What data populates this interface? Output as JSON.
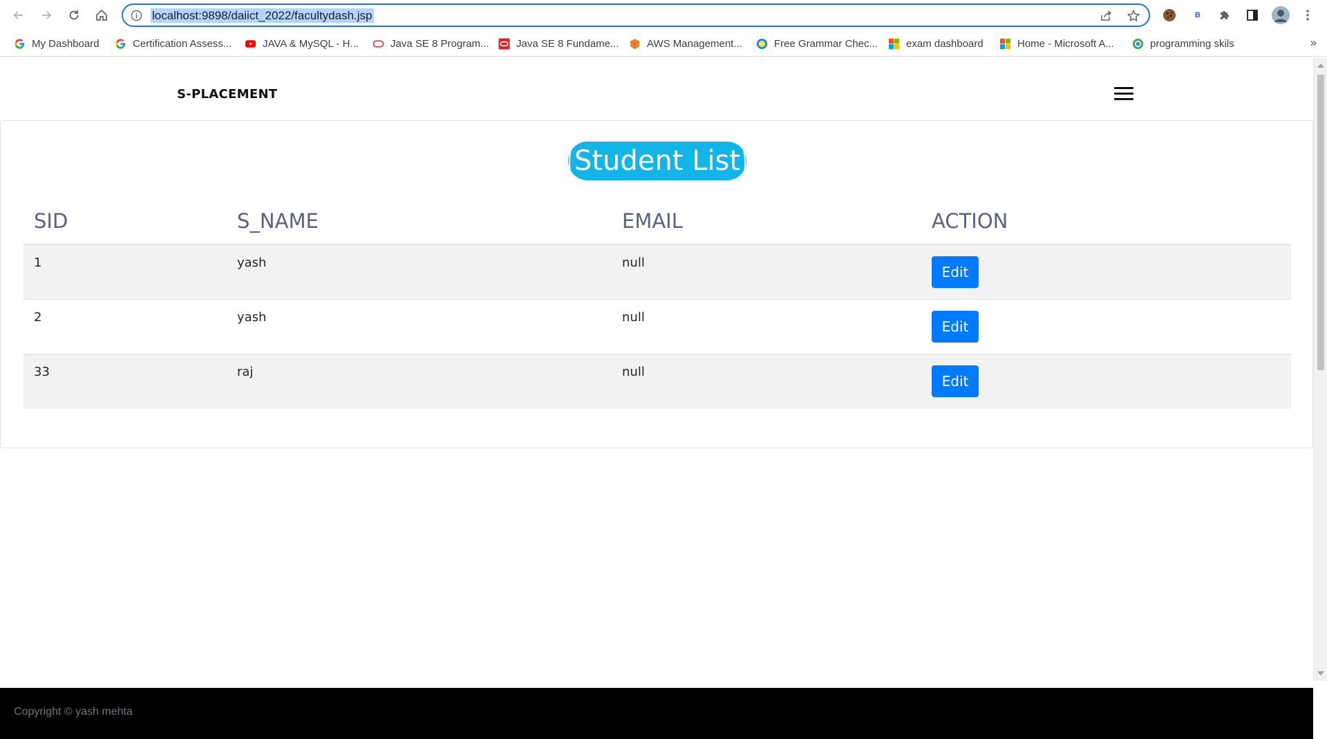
{
  "browser": {
    "url": "localhost:9898/daiict_2022/facultydash.jsp",
    "bookmarks": [
      {
        "label": "My Dashboard",
        "icon": "google-icon"
      },
      {
        "label": "Certification Assess...",
        "icon": "google-icon"
      },
      {
        "label": "JAVA & MySQL - H...",
        "icon": "youtube-icon"
      },
      {
        "label": "Java SE 8 Program...",
        "icon": "oracle-icon"
      },
      {
        "label": "Java SE 8 Fundame...",
        "icon": "oracle-icon"
      },
      {
        "label": "AWS Management...",
        "icon": "aws-icon"
      },
      {
        "label": "Free Grammar Chec...",
        "icon": "grammar-icon"
      },
      {
        "label": "exam dashboard",
        "icon": "microsoft-icon"
      },
      {
        "label": "Home - Microsoft A...",
        "icon": "microsoft-icon"
      },
      {
        "label": "programming skils",
        "icon": "chrome-icon"
      }
    ],
    "more": "»",
    "extension_letter": "B"
  },
  "navbar": {
    "brand": "S-PLACEMENT"
  },
  "main": {
    "title": "Student List",
    "columns": [
      "SID",
      "S_NAME",
      "EMAIL",
      "ACTION"
    ],
    "rows": [
      {
        "sid": "1",
        "name": "yash",
        "email": "null",
        "action": "Edit"
      },
      {
        "sid": "2",
        "name": "yash",
        "email": "null",
        "action": "Edit"
      },
      {
        "sid": "33",
        "name": "raj",
        "email": "null",
        "action": "Edit"
      }
    ]
  },
  "footer": {
    "text": "Copyright © yash mehta"
  },
  "colors": {
    "accent": "#13b4e7",
    "button": "#007bff",
    "header_text": "#5a6183"
  }
}
